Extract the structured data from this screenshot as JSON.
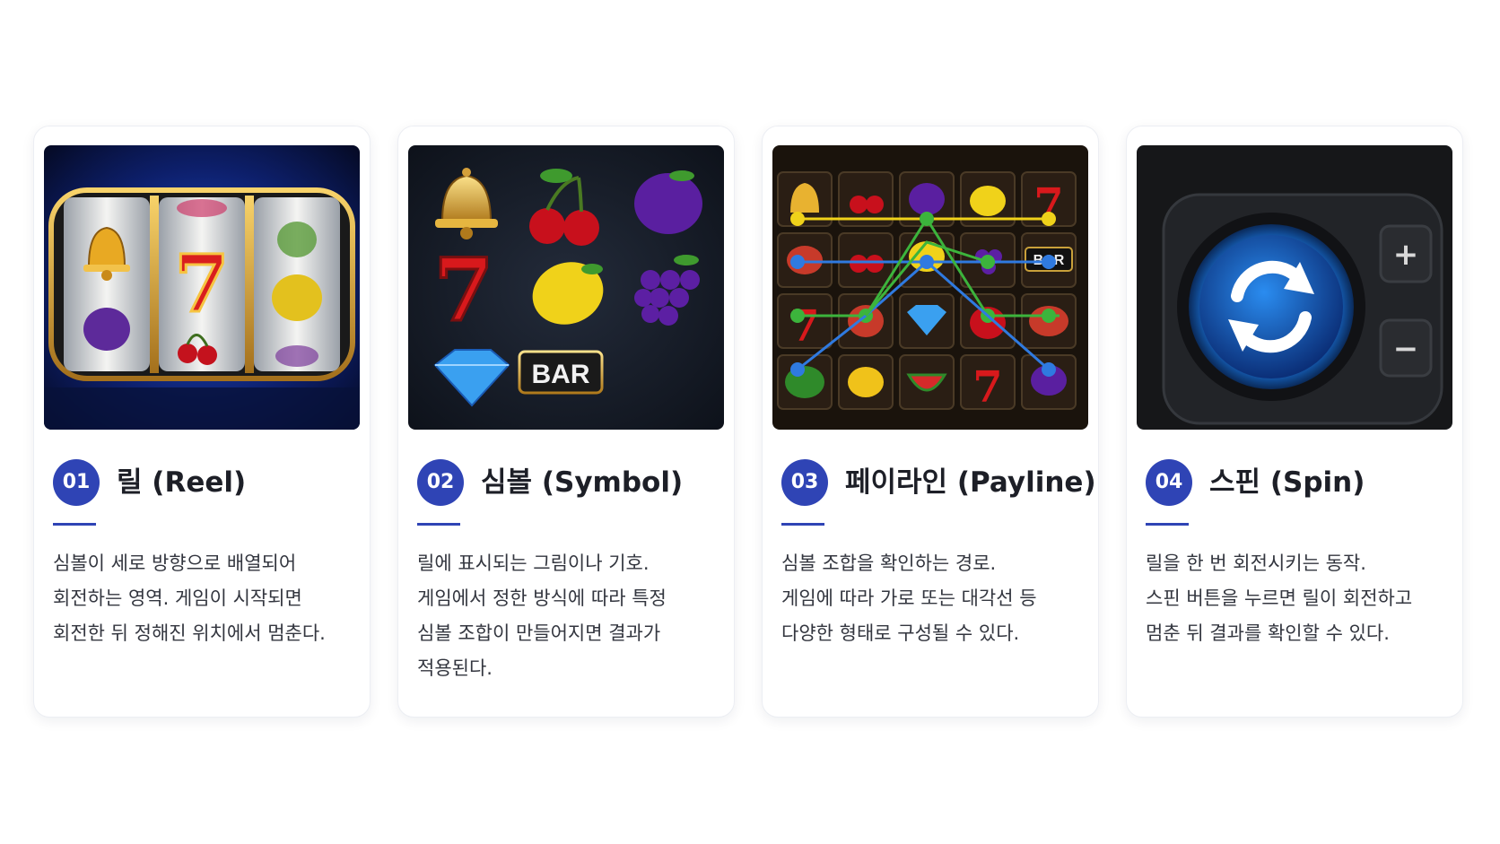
{
  "cards": [
    {
      "image": "slot-reels-illustration",
      "number": "01",
      "title": "릴 (Reel)",
      "lines": [
        "심볼이 세로 방향으로 배열되어",
        "회전하는 영역. 게임이 시작되면",
        "회전한 뒤 정해진 위치에서 멈춘다."
      ]
    },
    {
      "image": "slot-symbols-illustration",
      "number": "02",
      "title": "심볼 (Symbol)",
      "symbol_label": "BAR",
      "lines": [
        "릴에 표시되는 그림이나 기호.",
        "게임에서 정한 방식에 따라 특정",
        "심볼 조합이 만들어지면 결과가",
        "적용된다."
      ]
    },
    {
      "image": "payline-grid-illustration",
      "number": "03",
      "title": "페이라인 (Payline)",
      "symbol_label": "BAR",
      "lines": [
        "심볼 조합을 확인하는 경로.",
        "게임에 따라 가로 또는 대각선 등",
        "다양한 형태로 구성될 수 있다."
      ]
    },
    {
      "image": "spin-button-illustration",
      "number": "04",
      "title": "스핀 (Spin)",
      "plus_label": "+",
      "minus_label": "−",
      "lines": [
        "릴을 한 번 회전시키는 동작.",
        "스핀 버튼을 누르면 릴이 회전하고",
        "멈춘 뒤 결과를 확인할 수 있다."
      ]
    }
  ],
  "colors": {
    "accent": "#2f44b5",
    "card_border": "#eceef3",
    "text": "#33363f",
    "title": "#1d1f27"
  }
}
